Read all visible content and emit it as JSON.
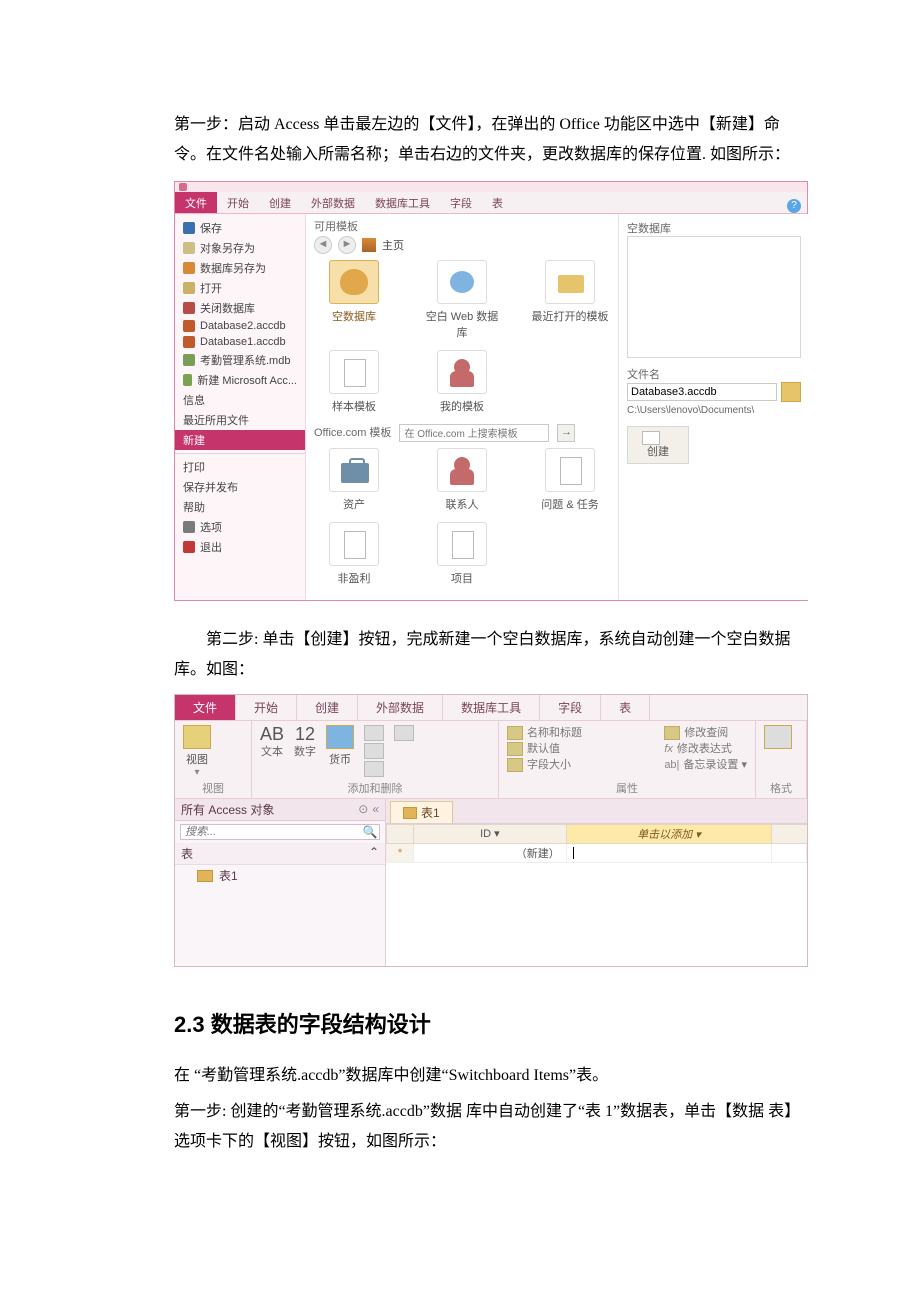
{
  "step1": "第一步：启动 Access 单击最左边的【文件】，在弹出的 Office 功能区中选中【新建】命令。在文件名处输入所需名称；单击右边的文件夹，更改数据库的保存位置. 如图所示：",
  "step2": "　　第二步: 单击【创建】按钮，完成新建一个空白数据库，系统自动创建一个空白数据库。如图：",
  "heading": "2.3 数据表的字段结构设计",
  "step3a": "    在 “考勤管理系统.accdb”数据库中创建“Switchboard Items”表。",
  "step3b": " 第一步: 创建的“考勤管理系统.accdb”数据 库中自动创建了“表 1”数据表，单击【数据 表】选项卡下的【视图】按钮，如图所示：",
  "shot1": {
    "tabs": {
      "file": "文件",
      "home": "开始",
      "create": "创建",
      "ext": "外部数据",
      "tools": "数据库工具",
      "field": "字段",
      "table": "表"
    },
    "left": {
      "save": "保存",
      "saveas_obj": "对象另存为",
      "saveas_db": "数据库另存为",
      "open": "打开",
      "close_db": "关闭数据库",
      "r1": "Database2.accdb",
      "r2": "Database1.accdb",
      "r3": "考勤管理系统.mdb",
      "r4": "新建 Microsoft Acc...",
      "info": "信息",
      "recent": "最近所用文件",
      "new": "新建",
      "print": "打印",
      "save_pub": "保存并发布",
      "help": "帮助",
      "options": "选项",
      "exit": "退出"
    },
    "center": {
      "avail": "可用模板",
      "home": "主页",
      "t_blank": "空数据库",
      "t_blankweb": "空白 Web 数据库",
      "t_recent": "最近打开的模板",
      "t_sample": "样本模板",
      "t_my": "我的模板",
      "officecom": "Office.com 模板",
      "searchph": "在 Office.com 上搜索模板",
      "go": "→",
      "t_asset": "资产",
      "t_contact": "联系人",
      "t_issue": "问题 & 任务",
      "t_nonprofit": "非盈利",
      "t_project": "项目"
    },
    "right": {
      "preview_label": "空数据库",
      "fname_label": "文件名",
      "fname_value": "Database3.accdb",
      "path": "C:\\Users\\lenovo\\Documents\\",
      "create": "创建"
    }
  },
  "shot2": {
    "tabs": {
      "file": "文件",
      "home": "开始",
      "create": "创建",
      "ext": "外部数据",
      "tools": "数据库工具",
      "field": "字段",
      "table": "表"
    },
    "grp_view_btn": "视图",
    "grp_view": "视图",
    "grp_ar": {
      "ab": "AB",
      "ab_cap": "文本",
      "n12": "12",
      "n12_cap": "数字",
      "cur": "货币"
    },
    "grp_ar_name": "添加和删除",
    "prop": {
      "l1": "名称和标题",
      "l2": "默认值",
      "l3": "字段大小"
    },
    "grp_prop_name": "属性",
    "propR": {
      "l1": "修改查阅",
      "l2": "修改表达式",
      "l3": "备忘录设置"
    },
    "grp_fmt": "格式",
    "nav": {
      "title": "所有 Access 对象",
      "search": "搜索...",
      "tables": "表",
      "t1": "表1"
    },
    "sheet": {
      "tab": "表1",
      "col_id": "ID",
      "col_add": "单击以添加",
      "row_new": "（新建）"
    }
  }
}
